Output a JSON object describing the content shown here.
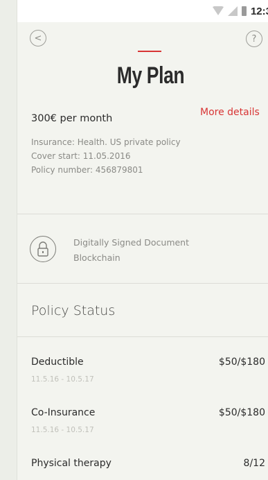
{
  "status_bar": {
    "time": "12:3"
  },
  "header": {
    "back_label": "<",
    "help_label": "?",
    "title": "My Plan"
  },
  "plan": {
    "price": "300€ per month",
    "more_details": "More details",
    "insurance": "Insurance: Health. US private policy",
    "cover_start": "Cover start: 11.05.2016",
    "policy_number": "Policy number: 456879801"
  },
  "signed_document": {
    "line1": "Digitally Signed Document",
    "line2": "Blockchain"
  },
  "policy_status": {
    "title": "Policy Status",
    "rows": [
      {
        "label": "Deductible",
        "period": "11.5.16 - 10.5.17",
        "value": "$50/$180"
      },
      {
        "label": "Co-Insurance",
        "period": "11.5.16 - 10.5.17",
        "value": "$50/$180"
      },
      {
        "label": "Physical therapy",
        "period": "",
        "value": "8/12"
      }
    ]
  },
  "colors": {
    "accent": "#d83535",
    "background": "#f3f4ef",
    "text": "#2b2b2b",
    "muted": "#8a8a86"
  },
  "icons": {
    "back": "chevron-left-icon",
    "help": "question-icon",
    "lock": "lock-icon",
    "wifi": "wifi-icon",
    "signal": "signal-icon",
    "battery": "battery-icon"
  }
}
